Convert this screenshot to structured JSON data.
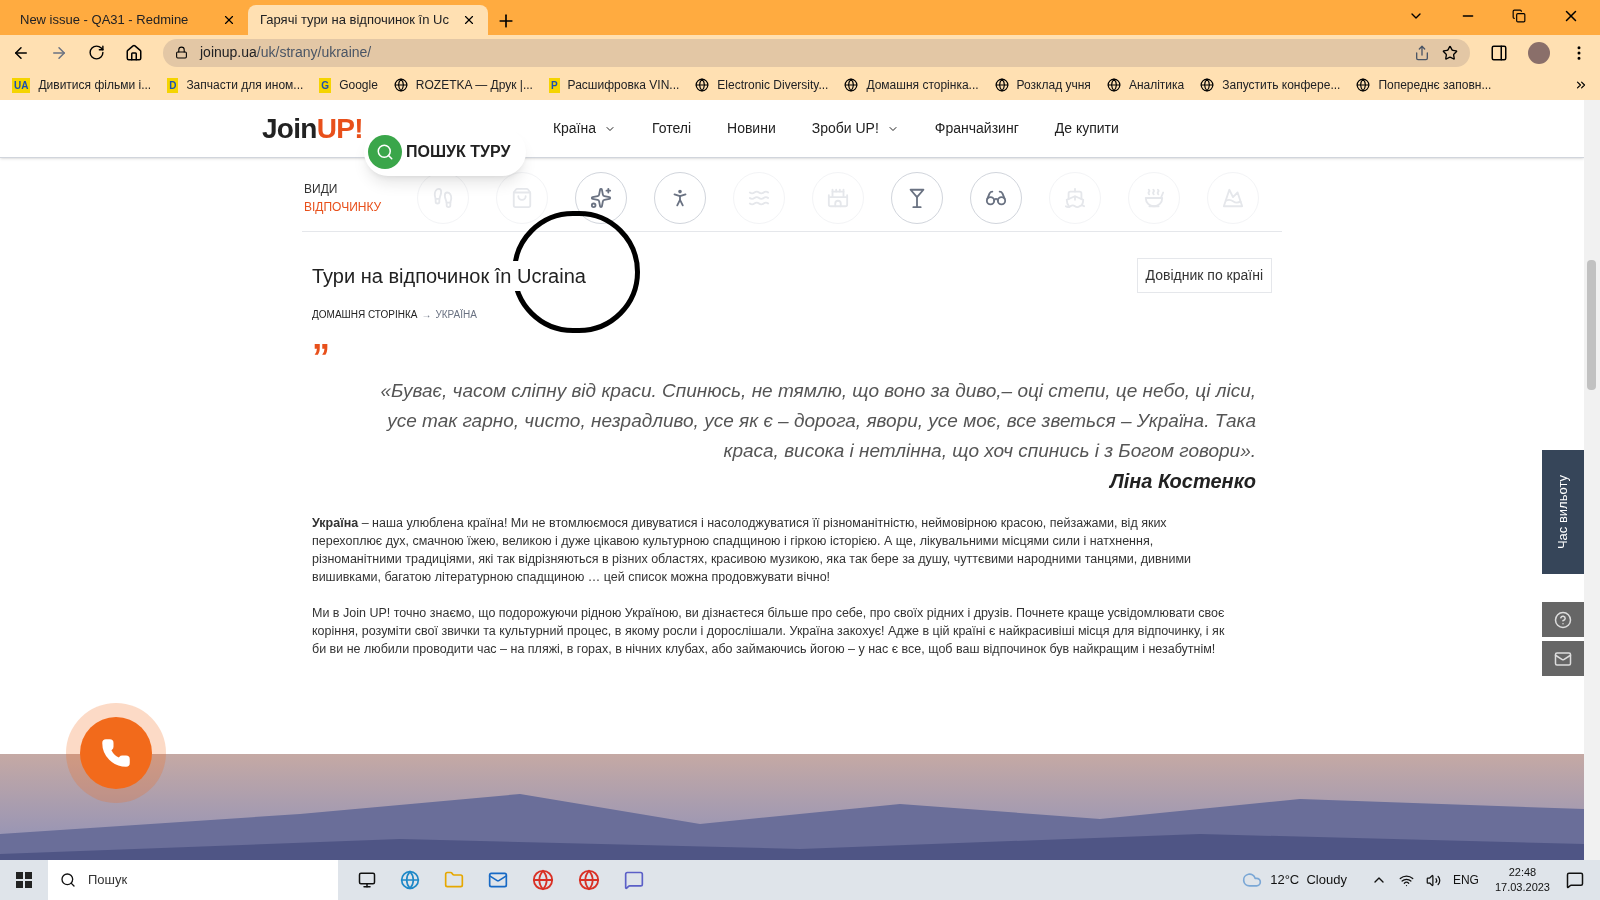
{
  "browser": {
    "tabs": [
      {
        "title": "New issue - QA31 - Redmine",
        "selected": false
      },
      {
        "title": "Гарячі тури на відпочинок în Uc",
        "selected": true
      }
    ],
    "url_host": "joinup.ua",
    "url_path": "/uk/strany/ukraine/",
    "bookmarks": [
      {
        "badge": "UA",
        "label": "Дивитися фільми і..."
      },
      {
        "badge": "D",
        "label": "Запчасти для ином..."
      },
      {
        "badge": "G",
        "label": "Google"
      },
      {
        "label": "ROZETKA — Друк |..."
      },
      {
        "badge": "P",
        "label": "Расшифровка VIN..."
      },
      {
        "label": "Electronic Diversity..."
      },
      {
        "label": "Домашня сторінка..."
      },
      {
        "label": "Розклад учня"
      },
      {
        "label": "Аналітика"
      },
      {
        "label": "Запустить конфере..."
      },
      {
        "label": "Попереднє заповн..."
      }
    ]
  },
  "site": {
    "logo_main": "Join",
    "logo_accent": "UP!",
    "search_button": "ПОШУК ТУРУ",
    "nav": [
      {
        "label": "Країна",
        "dropdown": true
      },
      {
        "label": "Готелі",
        "dropdown": false
      },
      {
        "label": "Новини",
        "dropdown": false
      },
      {
        "label": "Зроби UP!",
        "dropdown": true
      },
      {
        "label": "Франчайзинг",
        "dropdown": false
      },
      {
        "label": "Де купити",
        "dropdown": false
      }
    ],
    "categories_label": [
      "ВИДИ",
      "ВІДПОЧИНКУ"
    ],
    "categories": [
      {
        "disabled": true
      },
      {
        "disabled": true
      },
      {
        "disabled": false
      },
      {
        "disabled": false
      },
      {
        "disabled": true
      },
      {
        "disabled": true
      },
      {
        "disabled": false
      },
      {
        "disabled": false
      },
      {
        "disabled": true
      },
      {
        "disabled": true
      },
      {
        "disabled": true
      }
    ],
    "title": "Тури на відпочинок în Ucraina",
    "guide_button": "Довідник по країні",
    "breadcrumb_separator": "→",
    "breadcrumb": [
      {
        "label": "ДОМАШНЯ СТОРІНКА",
        "current": false
      },
      {
        "label": "УКРАЇНА",
        "current": true
      }
    ],
    "quote_mark": "”",
    "quote": "«Буває, часом сліпну від краси. Спинюсь, не тямлю, що воно за диво,– оці степи, це небо, ці ліси, усе так гарно, чисто, незрадливо, усе як є – дорога, явори, усе моє, все зветься – Україна. Така краса, висока і нетлінна, що хоч спинись і з Богом говори».",
    "quote_author": "Ліна Костенко",
    "paragraphs": [
      "**Україна** – наша улюблена країна! Ми не втомлюємося дивуватися і насолоджуватися її різноманітністю, неймовірною красою, пейзажами, від яких перехоплює дух, смачною їжею, великою і дуже цікавою культурною спадщиною і гіркою історією. А ще, лікувальними місцями сили і натхнення, різноманітними традиціями, які так відрізняються в різних областях, красивою музикою, яка так бере за душу, чуттєвими народними танцями, дивними вишивками, багатою літературною спадщиною … цей список можна продовжувати вічно!",
      "Ми в Join UP! точно знаємо, що подорожуючи рідною Україною, ви дізнаєтеся більше про себе, про своїх рідних і друзів. Почнете краще усвідомлювати своє коріння, розуміти свої звички та культурний процес, в якому росли і дорослішали. Україна закохує! Адже в цій країні є найкрасивіші місця для відпочинку, і як би ви не любили проводити час – на пляжі, в горах, в нічних клубах, або займаючись йогою – у нас є все, щоб ваш відпочинок був найкращим і незабутнім!"
    ],
    "departure_tab": "Час вильоту"
  },
  "taskbar": {
    "search_placeholder": "Пошук",
    "weather": "12°C  Cloudy",
    "language": "ENG",
    "time": "22:48",
    "date": "17.03.2023"
  }
}
